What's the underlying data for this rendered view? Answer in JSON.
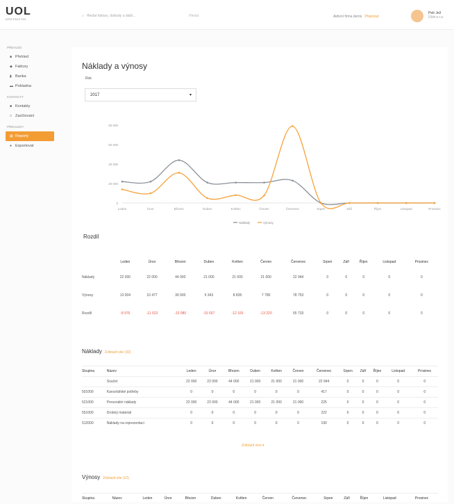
{
  "logo": {
    "title": "UOL",
    "subtitle": "ÚČETNICTVÍ"
  },
  "search": {
    "placeholder": "Hledat faktury, doklady a další...",
    "hint": "Hledat"
  },
  "account": {
    "company": "Aktivní firma demo",
    "switch": "Přepnout"
  },
  "user": {
    "name": "Petr Jež",
    "sub": "Účet s.r.o."
  },
  "sidebar": {
    "sections": [
      {
        "heading": "Přehled",
        "items": [
          {
            "icon": "home-icon",
            "glyph": "■",
            "label": "Přehled"
          },
          {
            "icon": "invoice-icon",
            "glyph": "◆",
            "label": "Faktury"
          },
          {
            "icon": "bank-icon",
            "glyph": "▮",
            "label": "Banka"
          },
          {
            "icon": "cash-icon",
            "glyph": "▬",
            "label": "Pokladna"
          }
        ]
      },
      {
        "heading": "Kontakty",
        "items": [
          {
            "icon": "contacts-icon",
            "glyph": "■",
            "label": "Kontakty"
          },
          {
            "icon": "document-icon",
            "glyph": "□",
            "label": "Zaúčtování"
          }
        ]
      },
      {
        "heading": "Přehledy",
        "items": [
          {
            "icon": "reports-icon",
            "glyph": "▤",
            "label": "Reporty",
            "active": true
          },
          {
            "icon": "export-icon",
            "glyph": "●",
            "label": "Exportovat"
          }
        ]
      }
    ]
  },
  "page": {
    "title": "Náklady a výnosy",
    "year_label": "Rok",
    "year_value": "2017"
  },
  "colors": {
    "accent": "#f39c33",
    "naklady": "#8a9099",
    "vynosy": "#f7a23b",
    "negative": "#e8574a"
  },
  "chart_data": {
    "type": "line",
    "categories": [
      "Leden",
      "Únor",
      "Březen",
      "Duben",
      "Květen",
      "Červen",
      "Červenec",
      "Srpen",
      "Září",
      "Říjen",
      "Listopad",
      "Prosinec"
    ],
    "series": [
      {
        "name": "Náklady",
        "values": [
          22000,
          22000,
          44000,
          21000,
          21000,
          21000,
          23000,
          0,
          0,
          0,
          0,
          0
        ]
      },
      {
        "name": "Výnosy",
        "values": [
          14000,
          10000,
          31000,
          5000,
          8000,
          7800,
          79000,
          0,
          0,
          0,
          0,
          0
        ]
      }
    ],
    "yticks": [
      "0",
      "20 000",
      "40 000",
      "60 000",
      "80 000"
    ],
    "ylim": [
      0,
      80000
    ],
    "legend": "bottom",
    "grid": false
  },
  "rozdil": {
    "title": "Rozdíl",
    "headers": [
      "",
      "Leden",
      "Únor",
      "Březen",
      "Duben",
      "Květen",
      "Červen",
      "Červenec",
      "Srpen",
      "Září",
      "Říjen",
      "Listopad",
      "Prosinec"
    ],
    "rows": [
      {
        "label": "Náklady",
        "cells": [
          "22 000",
          "22 000",
          "44 000",
          "21 000",
          "21 000",
          "21 000",
          "22 944",
          "0",
          "0",
          "0",
          "0",
          "0"
        ]
      },
      {
        "label": "Výnosy",
        "cells": [
          "13 004",
          "10 477",
          "30 000",
          "5 343",
          "8 835",
          "7 780",
          "78 753",
          "0",
          "0",
          "0",
          "0",
          "0"
        ]
      },
      {
        "label": "Rozdíl",
        "cells": [
          "-8 976",
          "-11 523",
          "-13 980",
          "-15 657",
          "-12 165",
          "-13 220",
          "55 733",
          "0",
          "0",
          "0",
          "0",
          "0"
        ]
      }
    ]
  },
  "naklady": {
    "title": "Náklady",
    "link": "Zobrazit vše (32)",
    "headers": [
      "Skupina",
      "Název",
      "Leden",
      "Únor",
      "Březen",
      "Duben",
      "Květen",
      "Červen",
      "Červenec",
      "Srpen",
      "Září",
      "Říjen",
      "Listopad",
      "Prosinec"
    ],
    "rows": [
      [
        "",
        "Součet",
        "22 000",
        "22 000",
        "44 000",
        "21 000",
        "21 000",
        "21 000",
        "22 944",
        "0",
        "0",
        "0",
        "0",
        "0"
      ],
      [
        "501000",
        "Kancelářské potřeby",
        "0",
        "0",
        "0",
        "0",
        "0",
        "0",
        "417",
        "0",
        "0",
        "0",
        "0",
        "0"
      ],
      [
        "521000",
        "Personální náklady",
        "22 000",
        "22 000",
        "44 000",
        "21 000",
        "21 000",
        "21 000",
        "225",
        "0",
        "0",
        "0",
        "0",
        "0"
      ],
      [
        "551000",
        "Drobný materiál",
        "0",
        "0",
        "0",
        "0",
        "0",
        "0",
        "222",
        "0",
        "0",
        "0",
        "0",
        "0"
      ],
      [
        "512000",
        "Náklady na reprezentaci",
        "0",
        "0",
        "0",
        "0",
        "0",
        "0",
        "190",
        "0",
        "0",
        "0",
        "0",
        "0"
      ]
    ],
    "more": "Zobrazit více ▾"
  },
  "vynosy": {
    "title": "Výnosy",
    "link": "Zobrazit vše (12)",
    "headers": [
      "Skupina",
      "Název",
      "Leden",
      "Únor",
      "Březen",
      "Duben",
      "Květen",
      "Červen",
      "Červenec",
      "Srpen",
      "Září",
      "Říjen",
      "Listopad",
      "Prosinec"
    ]
  }
}
